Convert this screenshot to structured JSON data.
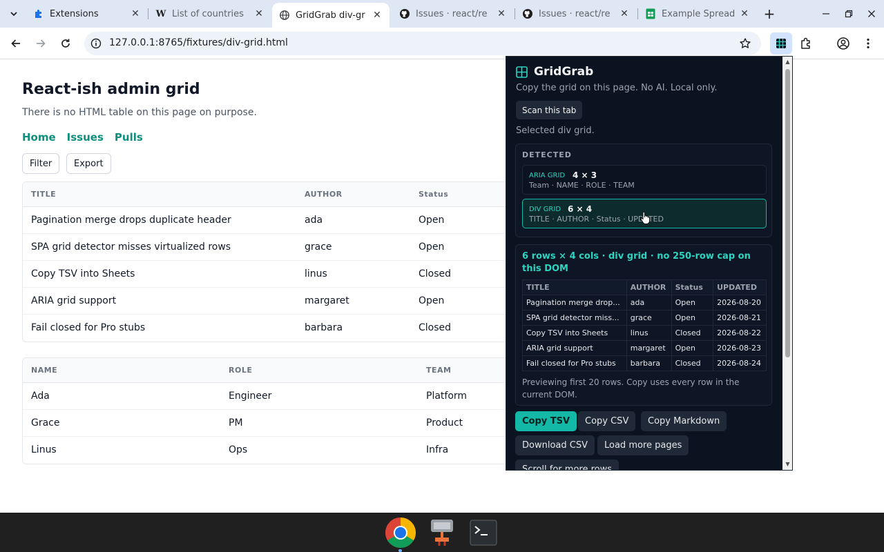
{
  "browser": {
    "tabs": [
      {
        "label": "Extensions",
        "icon": "puzzle-icon",
        "active": false
      },
      {
        "label": "List of countries",
        "icon": "wikipedia-icon",
        "active": false
      },
      {
        "label": "GridGrab div-gr",
        "icon": "globe-icon",
        "active": true
      },
      {
        "label": "Issues · react/re",
        "icon": "github-icon",
        "active": false
      },
      {
        "label": "Issues · react/re",
        "icon": "github-icon",
        "active": false
      },
      {
        "label": "Example Spread",
        "icon": "sheets-icon",
        "active": false
      }
    ],
    "url": "127.0.0.1:8765/fixtures/div-grid.html"
  },
  "page": {
    "title": "React-ish admin grid",
    "subtitle": "There is no HTML table on this page on purpose.",
    "nav": [
      "Home",
      "Issues",
      "Pulls"
    ],
    "buttons": {
      "filter": "Filter",
      "export": "Export"
    },
    "issues_grid": {
      "headers": [
        "TITLE",
        "AUTHOR",
        "Status"
      ],
      "rows": [
        [
          "Pagination merge drops duplicate header",
          "ada",
          "Open"
        ],
        [
          "SPA grid detector misses virtualized rows",
          "grace",
          "Open"
        ],
        [
          "Copy TSV into Sheets",
          "linus",
          "Closed"
        ],
        [
          "ARIA grid support",
          "margaret",
          "Open"
        ],
        [
          "Fail closed for Pro stubs",
          "barbara",
          "Closed"
        ]
      ]
    },
    "team_grid": {
      "headers": [
        "NAME",
        "ROLE",
        "TEAM"
      ],
      "rows": [
        [
          "Ada",
          "Engineer",
          "Platform"
        ],
        [
          "Grace",
          "PM",
          "Product"
        ],
        [
          "Linus",
          "Ops",
          "Infra"
        ]
      ]
    }
  },
  "extension": {
    "name": "GridGrab",
    "tagline": "Copy the grid on this page. No AI. Local only.",
    "scan_button": "Scan this tab",
    "status": "Selected div grid.",
    "detected_label": "DETECTED",
    "detected": [
      {
        "kind": "ARIA GRID",
        "dims": "4 × 3",
        "cols": "Team · NAME · ROLE · TEAM",
        "selected": false
      },
      {
        "kind": "DIV GRID",
        "dims": "6 × 4",
        "cols": "TITLE · AUTHOR · Status · UPDATED",
        "selected": true
      }
    ],
    "summary": "6 rows × 4 cols · div grid · no 250-row cap on this DOM",
    "preview": {
      "headers": [
        "TITLE",
        "AUTHOR",
        "Status",
        "UPDATED"
      ],
      "rows": [
        [
          "Pagination merge drop...",
          "ada",
          "Open",
          "2026-08-20"
        ],
        [
          "SPA grid detector miss...",
          "grace",
          "Open",
          "2026-08-21"
        ],
        [
          "Copy TSV into Sheets",
          "linus",
          "Closed",
          "2026-08-22"
        ],
        [
          "ARIA grid support",
          "margaret",
          "Open",
          "2026-08-23"
        ],
        [
          "Fail closed for Pro stubs",
          "barbara",
          "Closed",
          "2026-08-24"
        ]
      ]
    },
    "preview_note": "Previewing first 20 rows. Copy uses every row in the current DOM.",
    "actions": {
      "copy_tsv": "Copy TSV",
      "copy_csv": "Copy CSV",
      "copy_markdown": "Copy Markdown",
      "download_csv": "Download CSV",
      "load_more": "Load more pages",
      "scroll_more": "Scroll for more rows"
    }
  },
  "colors": {
    "accent": "#14b8a6",
    "link": "#0f8f7e",
    "popup_bg": "#0b1220"
  }
}
